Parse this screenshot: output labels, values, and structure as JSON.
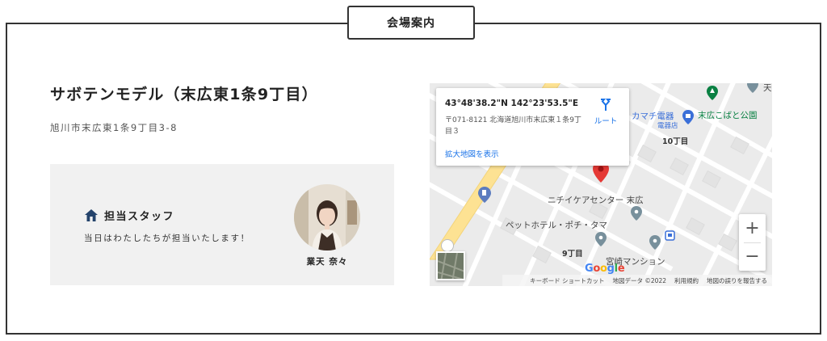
{
  "section": {
    "title": "会場案内"
  },
  "venue": {
    "title": "サボテンモデル（末広東1条9丁目）",
    "address": "旭川市末広東1条9丁目3-8"
  },
  "staff": {
    "heading": "担当スタッフ",
    "note": "当日はわたしたちが担当いたします！",
    "name": "業天 奈々"
  },
  "map": {
    "info": {
      "coords": "43°48'38.2\"N 142°23'53.5\"E",
      "address": "〒071-8121 北海道旭川市末広東１条9丁目３",
      "enlarge_link": "拡大地図を表示",
      "route_label": "ルート"
    },
    "labels": {
      "park": "末広こばと公園",
      "store": "カマチ電器",
      "store_sub": "電器店",
      "block10": "10丁目",
      "care_center": "ニチイケアセンター 末広",
      "pet_hotel": "ペットホテル・ポチ・タマ",
      "block9": "9丁目",
      "mansion": "宮崎マンション",
      "corner": "天"
    },
    "zoom_in": "+",
    "zoom_out": "−",
    "google": "Google",
    "attribution": {
      "shortcuts": "キーボード ショートカット",
      "data": "地図データ ©2022",
      "terms": "利用規約",
      "report": "地図の誤りを報告する"
    },
    "colors": {
      "pin": "#e53935",
      "poi": "#78909c",
      "park": "#0a8043",
      "shop": "#3a6fd8",
      "road": "#fde293"
    }
  }
}
